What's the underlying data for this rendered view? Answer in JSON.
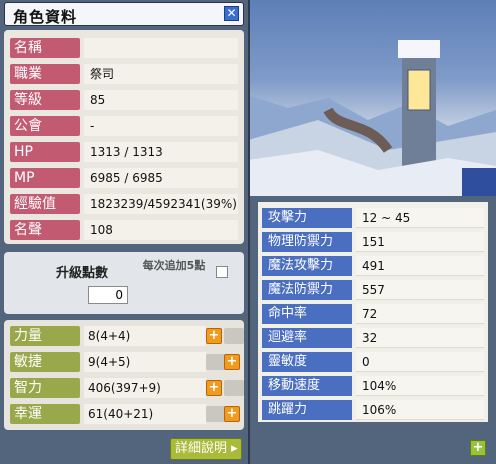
{
  "window": {
    "title": "角色資料",
    "close_icon": "close-icon"
  },
  "profile": [
    {
      "label": "名稱",
      "value": ""
    },
    {
      "label": "職業",
      "value": "祭司"
    },
    {
      "label": "等級",
      "value": "85"
    },
    {
      "label": "公會",
      "value": "-"
    },
    {
      "label": "HP",
      "value": "1313 / 1313"
    },
    {
      "label": "MP",
      "value": "6985 / 6985"
    },
    {
      "label": "經驗值",
      "value": "1823239/4592341(39%)"
    },
    {
      "label": "名聲",
      "value": "108"
    }
  ],
  "ability_points": {
    "label": "升級點數",
    "value": "0",
    "auto_add_label": "每次追加5點"
  },
  "stats": [
    {
      "label": "力量",
      "value": "8(4+4)"
    },
    {
      "label": "敏捷",
      "value": "9(4+5)"
    },
    {
      "label": "智力",
      "value": "406(397+9)"
    },
    {
      "label": "幸運",
      "value": "61(40+21)"
    }
  ],
  "detail_button": {
    "label": "詳細說明 ▸"
  },
  "combat": [
    {
      "label": "攻擊力",
      "value": "12 ~ 45"
    },
    {
      "label": "物理防禦力",
      "value": "151"
    },
    {
      "label": "魔法攻擊力",
      "value": "491"
    },
    {
      "label": "魔法防禦力",
      "value": "557"
    },
    {
      "label": "命中率",
      "value": "72"
    },
    {
      "label": "迴避率",
      "value": "32"
    },
    {
      "label": "靈敏度",
      "value": "0"
    },
    {
      "label": "移動速度",
      "value": "104%"
    },
    {
      "label": "跳躍力",
      "value": "106%"
    }
  ],
  "colors": {
    "profile_label": "#c25a72",
    "stat_label": "#98a84a",
    "combat_label": "#4a6fc0",
    "plus_button": "#f29a1d"
  }
}
